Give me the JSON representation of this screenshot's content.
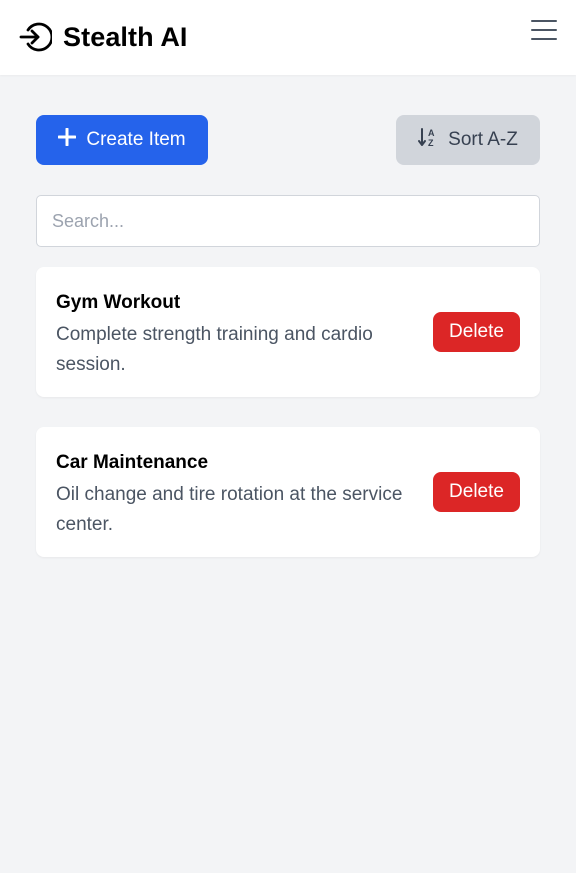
{
  "app": {
    "title": "Stealth AI",
    "brand_icon": "sign-in-arrow-icon",
    "menu_icon": "hamburger-menu-icon"
  },
  "toolbar": {
    "create_label": "Create Item",
    "create_icon": "plus-icon",
    "sort_label": "Sort A-Z",
    "sort_icon": "sort-alpha-down-icon"
  },
  "search": {
    "placeholder": "Search...",
    "value": ""
  },
  "items": [
    {
      "title": "Gym Workout",
      "description": "Complete strength training and cardio session.",
      "delete_label": "Delete"
    },
    {
      "title": "Car Maintenance",
      "description": "Oil change and tire rotation at the service center.",
      "delete_label": "Delete"
    }
  ],
  "colors": {
    "primary": "#2563eb",
    "danger": "#dc2626",
    "secondary": "#d1d5db",
    "background": "#f3f4f6"
  }
}
